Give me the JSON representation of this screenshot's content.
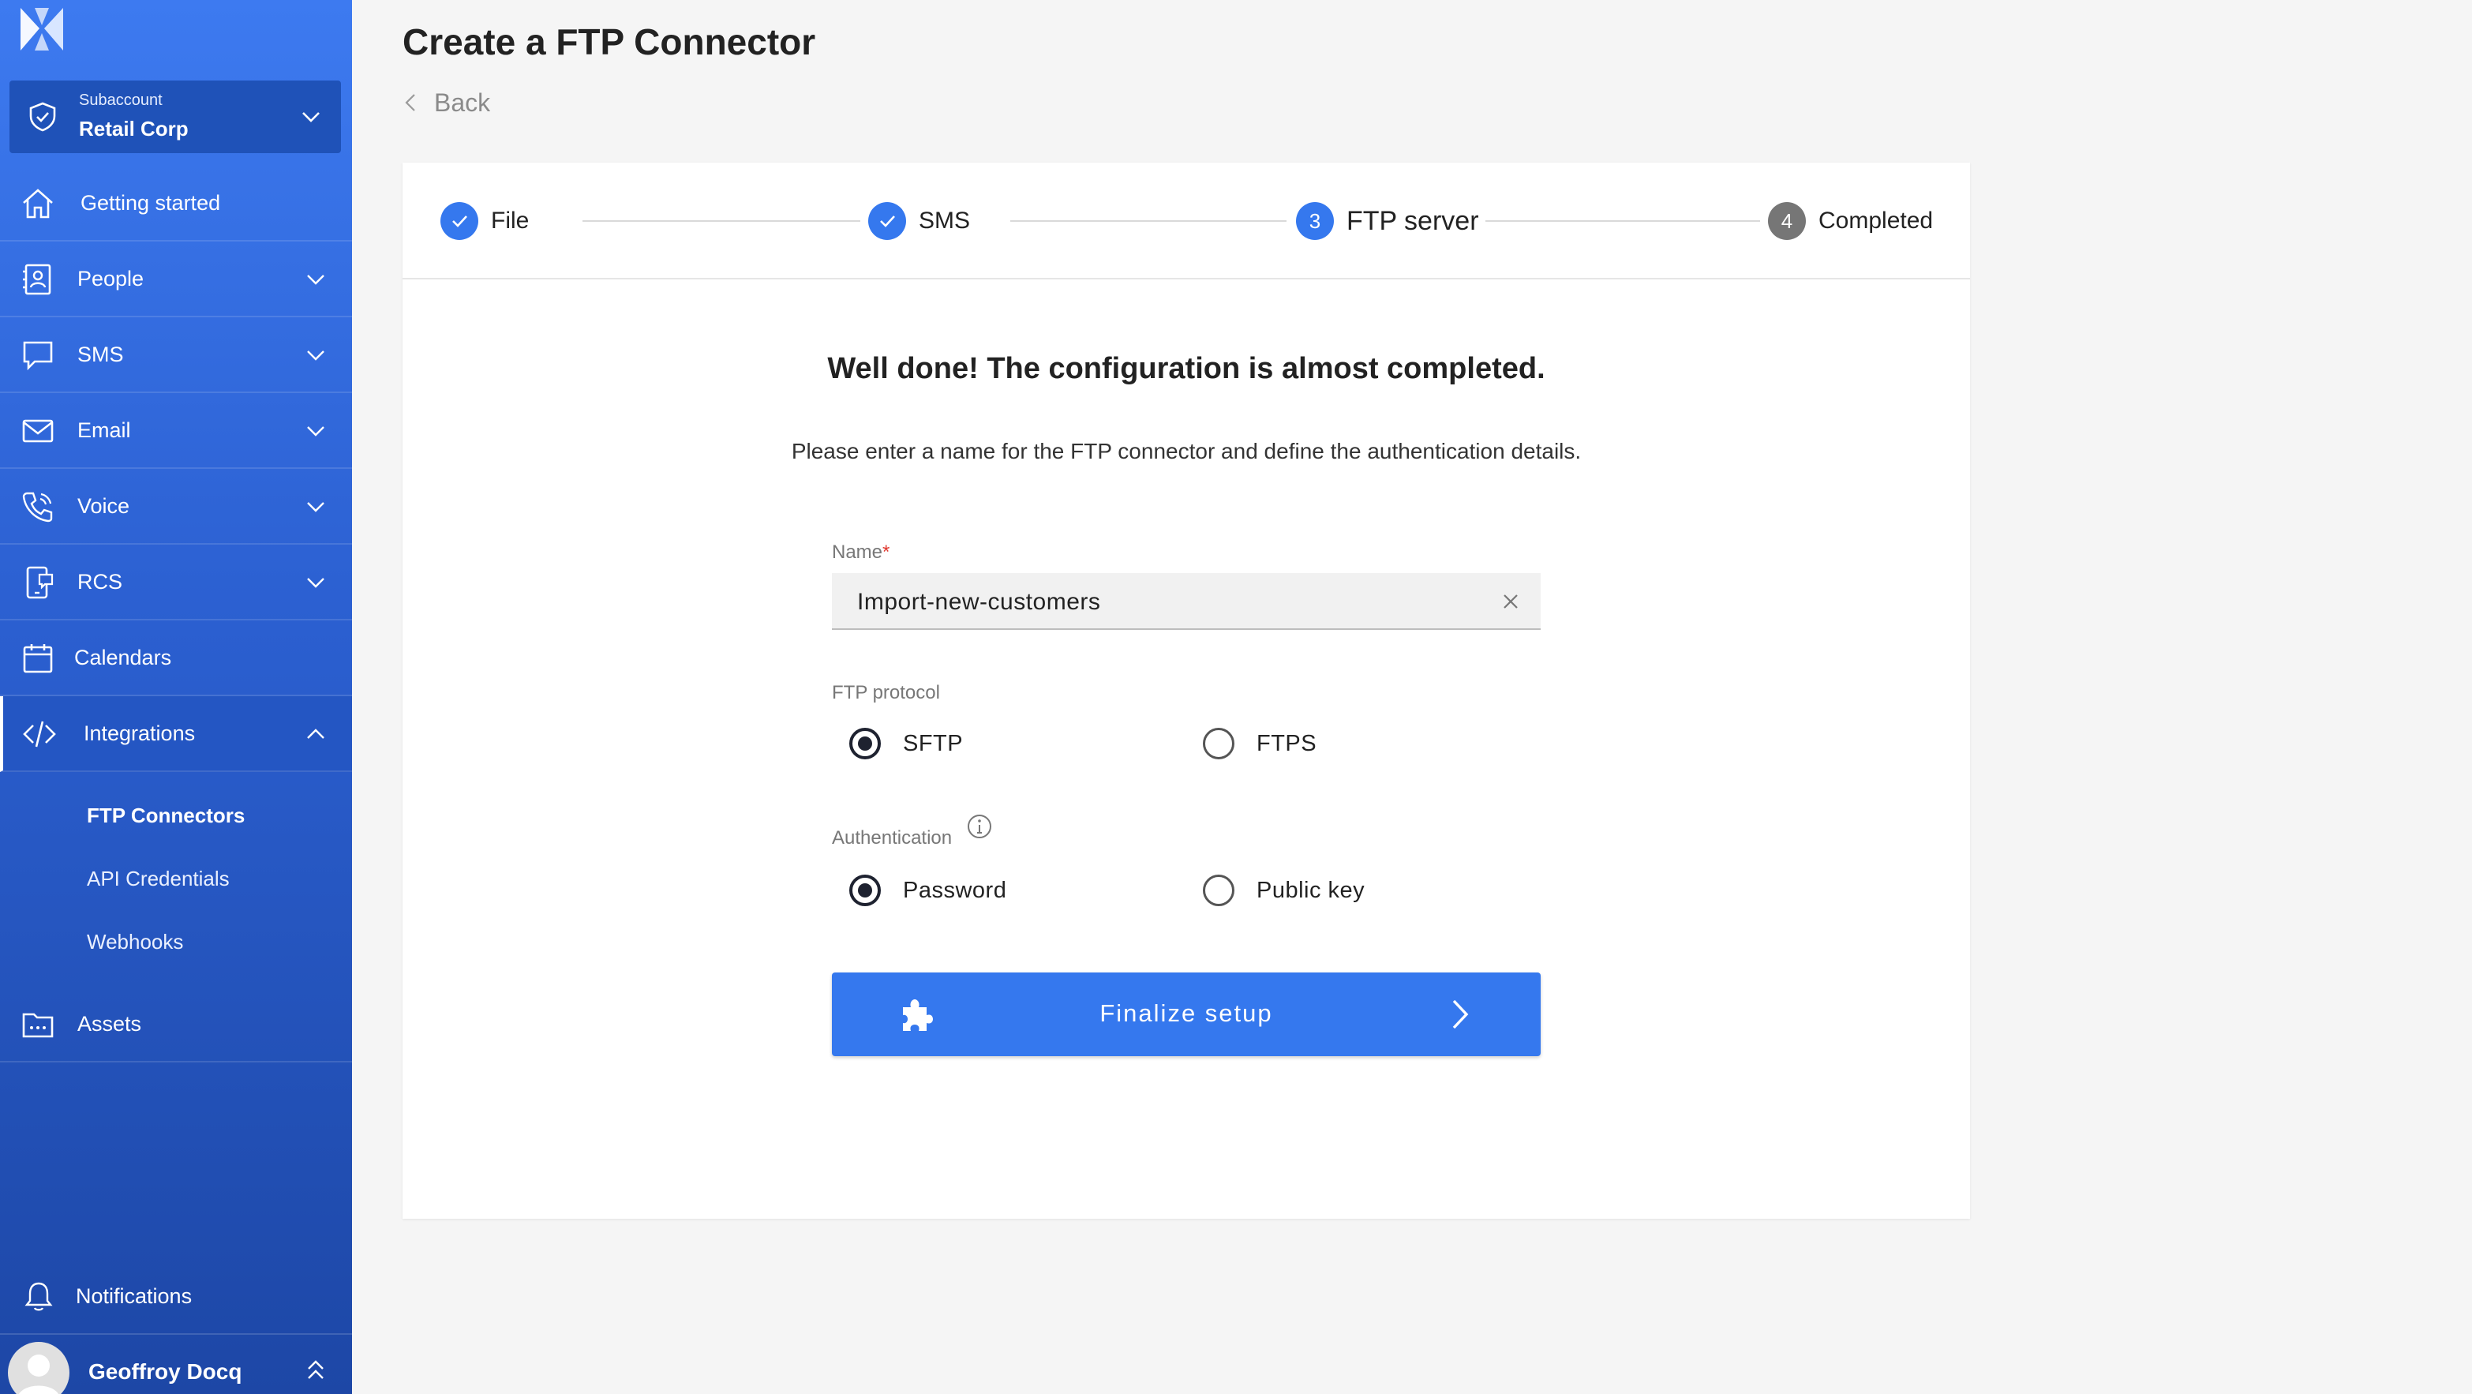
{
  "sidebar": {
    "subaccount": {
      "label": "Subaccount",
      "name": "Retail Corp"
    },
    "items": [
      {
        "label": "Getting started",
        "icon": "home-icon"
      },
      {
        "label": "People",
        "icon": "contact-book-icon"
      },
      {
        "label": "SMS",
        "icon": "chat-bubble-icon"
      },
      {
        "label": "Email",
        "icon": "envelope-icon"
      },
      {
        "label": "Voice",
        "icon": "phone-icon"
      },
      {
        "label": "RCS",
        "icon": "mobile-chat-icon"
      },
      {
        "label": "Calendars",
        "icon": "calendar-icon"
      },
      {
        "label": "Integrations",
        "icon": "code-icon"
      },
      {
        "label": "Assets",
        "icon": "folder-icon"
      }
    ],
    "integrations_sub": [
      "FTP Connectors",
      "API Credentials",
      "Webhooks"
    ],
    "notifications": "Notifications",
    "user_name": "Geoffroy Docq"
  },
  "page": {
    "title": "Create a FTP Connector",
    "back": "Back"
  },
  "stepper": {
    "steps": [
      {
        "number": "1",
        "label": "File",
        "state": "done"
      },
      {
        "number": "2",
        "label": "SMS",
        "state": "done"
      },
      {
        "number": "3",
        "label": "FTP server",
        "state": "current"
      },
      {
        "number": "4",
        "label": "Completed",
        "state": "pending"
      }
    ]
  },
  "form": {
    "heading": "Well done! The configuration is almost completed.",
    "subtext": "Please enter a name for the FTP connector and define the authentication details.",
    "name_label": "Name",
    "required_mark": "*",
    "name_value": "Import-new-customers",
    "protocol_label": "FTP protocol",
    "protocol_options": [
      "SFTP",
      "FTPS"
    ],
    "protocol_selected": "SFTP",
    "auth_label": "Authentication",
    "auth_options": [
      "Password",
      "Public key"
    ],
    "auth_selected": "Password",
    "submit_label": "Finalize setup"
  },
  "colors": {
    "primary": "#3578ee",
    "sidebar_top": "#3d7af0",
    "sidebar_bottom": "#1d47a6",
    "pending_step": "#767676",
    "required": "#e0382f"
  }
}
